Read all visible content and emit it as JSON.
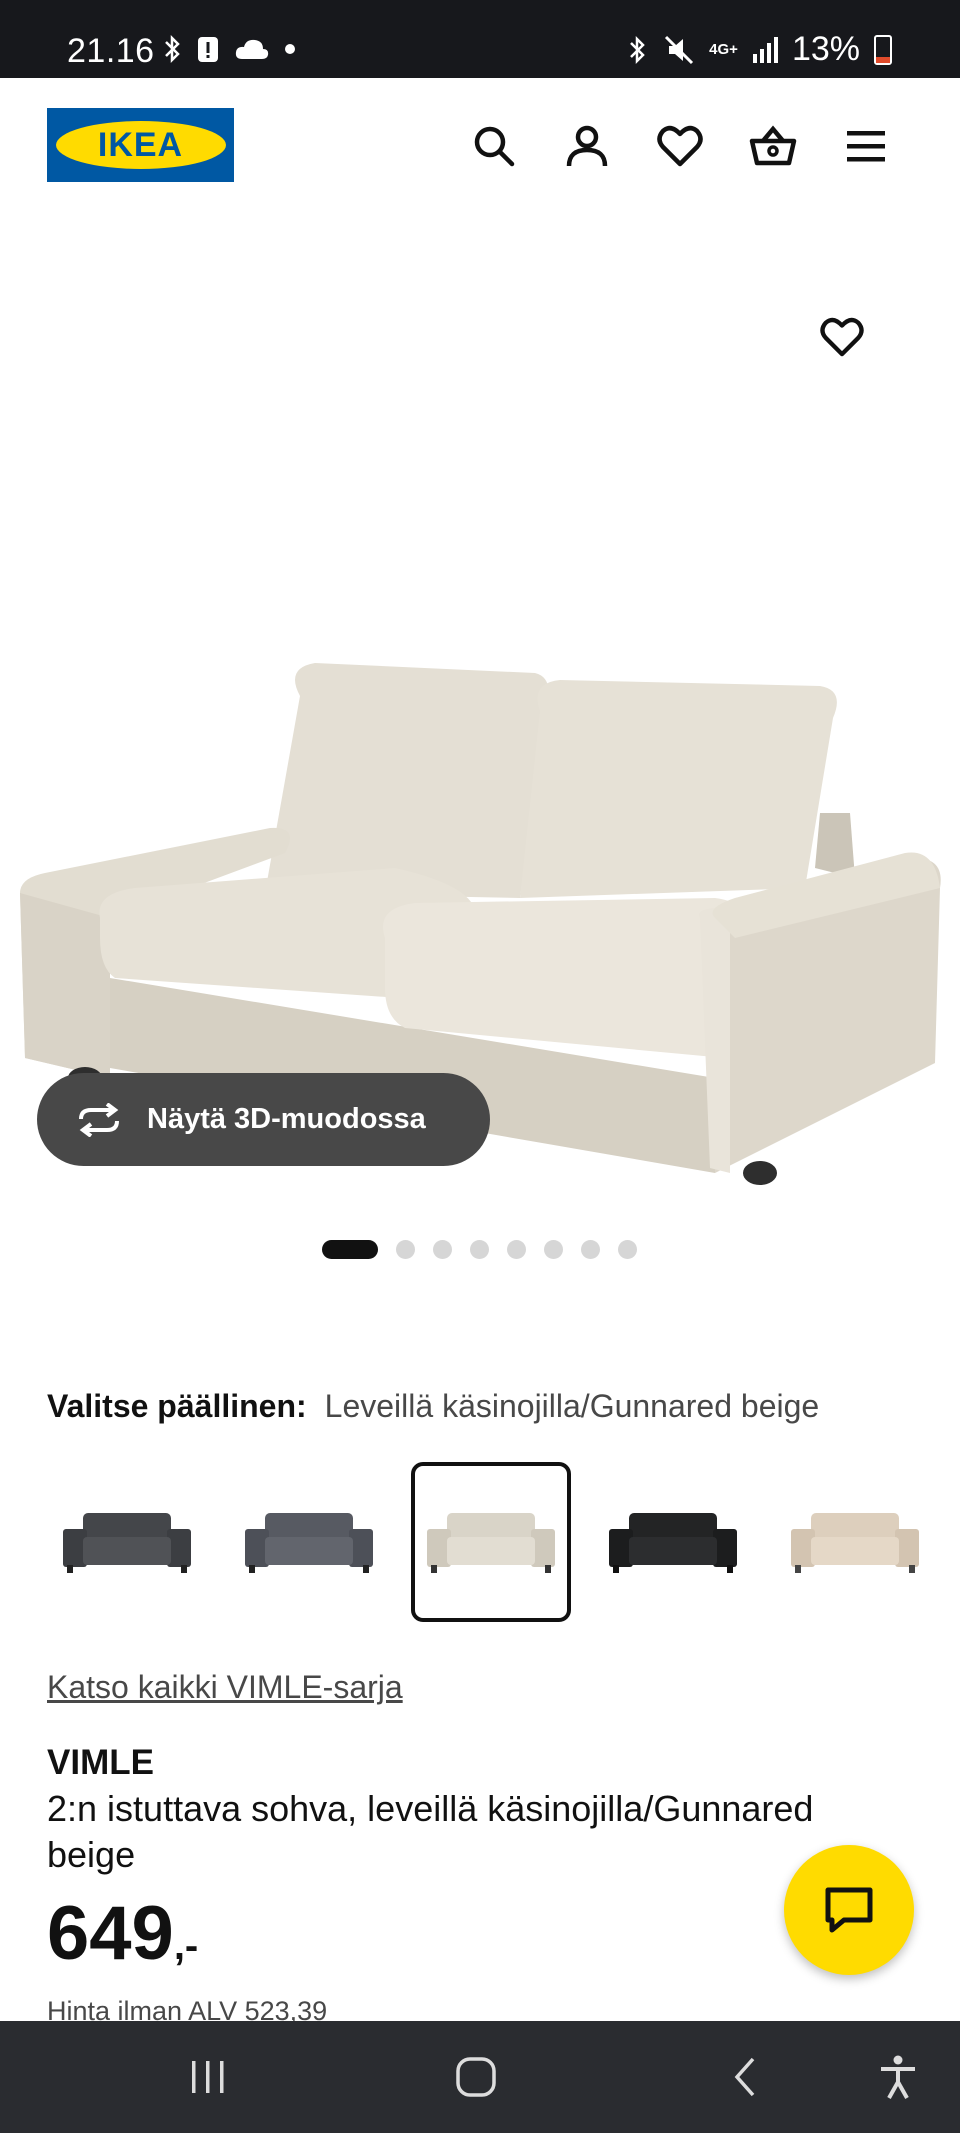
{
  "status_bar": {
    "time": "21.16",
    "network": "4G+",
    "battery": "13%"
  },
  "header": {
    "logo_text": "IKEA",
    "icons": [
      "search-icon",
      "account-icon",
      "heart-icon",
      "cart-icon",
      "menu-icon"
    ]
  },
  "gallery": {
    "view_3d_label": "Näytä 3D-muodossa",
    "dot_count": 8,
    "active_index": 0
  },
  "cover": {
    "label": "Valitse päällinen:",
    "selected_value": "Leveillä käsinojilla/Gunnared beige",
    "swatches": [
      {
        "color": "#4a4c50"
      },
      {
        "color": "#5b5e66"
      },
      {
        "color": "#d8d2c6",
        "selected": true
      },
      {
        "color": "#262728"
      },
      {
        "color": "#dcccb8"
      }
    ]
  },
  "product": {
    "series_link": "Katso kaikki VIMLE-sarja",
    "name": "VIMLE",
    "description": "2:n istuttava sohva, leveillä käsinojilla/Gunnared beige",
    "price": "649",
    "price_suffix": ",-",
    "vat_text": "Hinta ilman ALV 523,39"
  },
  "colors": {
    "ikea_blue": "#0058a3",
    "ikea_yellow": "#ffdb00",
    "button_dark": "#484848"
  }
}
